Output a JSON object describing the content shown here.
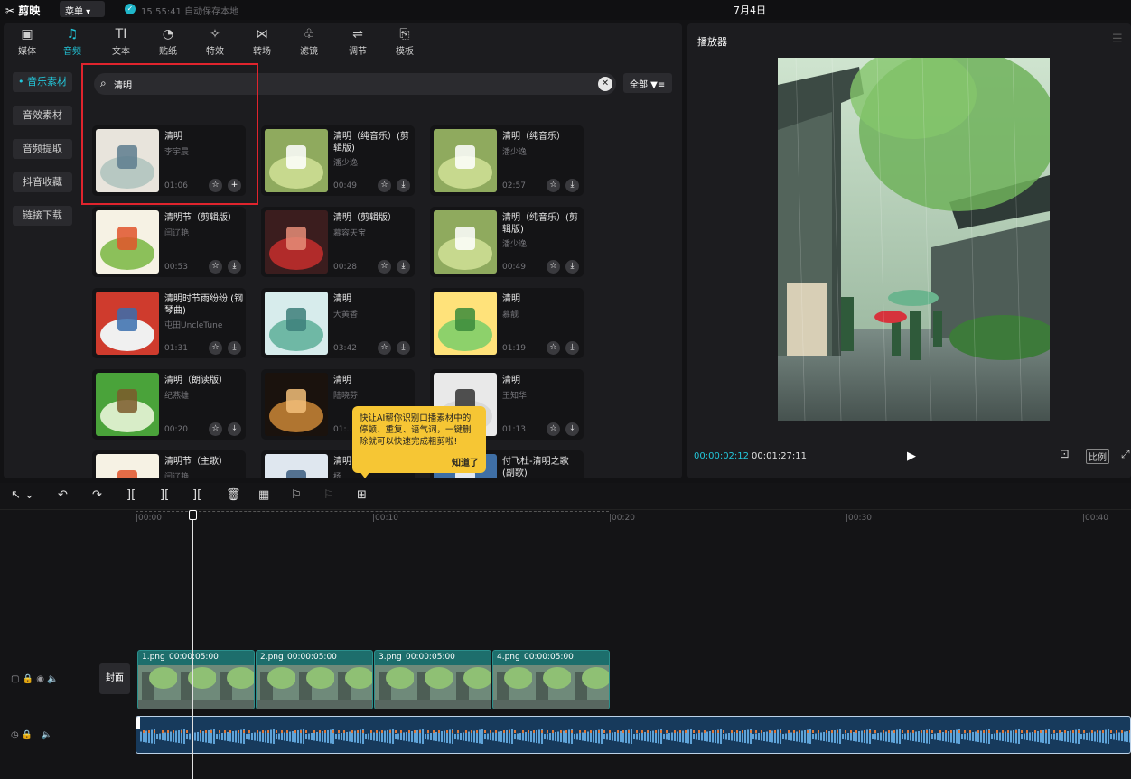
{
  "topbar": {
    "logo": "剪映",
    "menu": "菜单",
    "autosave": "15:55:41 自动保存本地",
    "date": "7月4日"
  },
  "tabs": [
    {
      "label": "媒体",
      "icon": "▣"
    },
    {
      "label": "音频",
      "icon": "♫"
    },
    {
      "label": "文本",
      "icon": "TI"
    },
    {
      "label": "贴纸",
      "icon": "◔"
    },
    {
      "label": "特效",
      "icon": "✧"
    },
    {
      "label": "转场",
      "icon": "⋈"
    },
    {
      "label": "滤镜",
      "icon": "♧"
    },
    {
      "label": "调节",
      "icon": "⇌"
    },
    {
      "label": "模板",
      "icon": "⎘"
    }
  ],
  "sidebar": [
    {
      "label": "• 音乐素材"
    },
    {
      "label": "音效素材"
    },
    {
      "label": "音频提取"
    },
    {
      "label": "抖音收藏"
    },
    {
      "label": "链接下载"
    }
  ],
  "search": {
    "value": "清明",
    "filter": "全部"
  },
  "cards": [
    {
      "title": "清明",
      "artist": "李宇晨",
      "duration": "01:06",
      "action": "+"
    },
    {
      "title": "清明（纯音乐）(剪辑版)",
      "artist": "潘少逸",
      "duration": "00:49",
      "action": "⤓"
    },
    {
      "title": "清明（纯音乐）",
      "artist": "潘少逸",
      "duration": "02:57",
      "action": "⤓"
    },
    {
      "title": "清明节（剪辑版）",
      "artist": "闫辽艳",
      "duration": "00:53",
      "action": "⤓"
    },
    {
      "title": "清明（剪辑版）",
      "artist": "慕容天宝",
      "duration": "00:28",
      "action": "⤓"
    },
    {
      "title": "清明（纯音乐）(剪辑版)",
      "artist": "潘少逸",
      "duration": "00:49",
      "action": "⤓"
    },
    {
      "title": "清明时节雨纷纷 (钢琴曲)",
      "artist": "屯田UncleTune",
      "duration": "01:31",
      "action": "⤓"
    },
    {
      "title": "清明",
      "artist": "大黄香",
      "duration": "03:42",
      "action": "⤓"
    },
    {
      "title": "清明",
      "artist": "慕靓",
      "duration": "01:19",
      "action": "⤓"
    },
    {
      "title": "清明（朗读版）",
      "artist": "纪燕雄",
      "duration": "00:20",
      "action": "⤓"
    },
    {
      "title": "清明",
      "artist": "陆晓芬",
      "duration": "01:...",
      "action": "⤓"
    },
    {
      "title": "清明",
      "artist": "王知华",
      "duration": "01:13",
      "action": "⤓"
    },
    {
      "title": "清明节（主歌）",
      "artist": "闫辽艳",
      "duration": "",
      "action": "⤓"
    },
    {
      "title": "清明",
      "artist": "杨...",
      "duration": "",
      "action": "⤓"
    },
    {
      "title": "付飞杜-清明之歌 (副歌)",
      "artist": "",
      "duration": "",
      "action": "⤓"
    }
  ],
  "tooltip": {
    "text": "快让AI帮你识别口播素材中的停顿、重复、语气词，一键删除就可以快速完成粗剪啦!",
    "ok": "知道了"
  },
  "player": {
    "title": "播放器",
    "current": "00:00:02:12",
    "total": "00:01:27:11",
    "ratio": "比例"
  },
  "ruler": [
    "|00:00",
    "|00:10",
    "|00:20",
    "|00:30",
    "|00:40"
  ],
  "clips": [
    {
      "name": "1.png",
      "time": "00:00:05:00"
    },
    {
      "name": "2.png",
      "time": "00:00:05:00"
    },
    {
      "name": "3.png",
      "time": "00:00:05:00"
    },
    {
      "name": "4.png",
      "time": "00:00:05:00"
    }
  ],
  "track": {
    "cover": "封面"
  },
  "colors": {
    "accent": "#23c6d9",
    "highlight": "#e0242d",
    "tooltip": "#f6c634"
  }
}
